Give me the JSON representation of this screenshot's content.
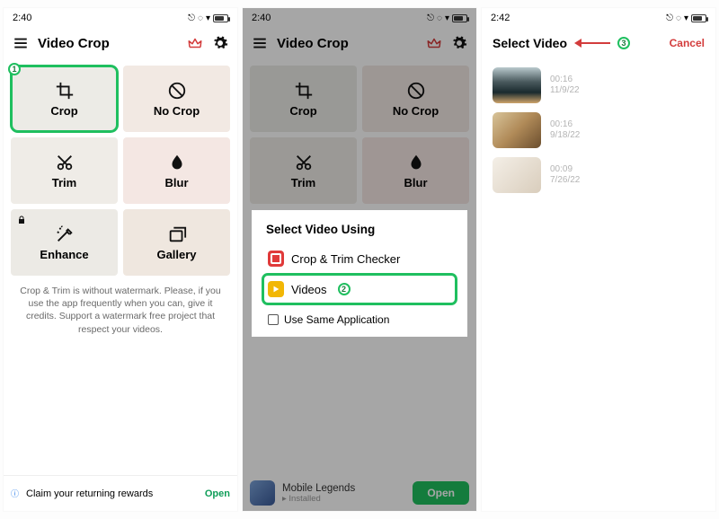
{
  "screen1": {
    "time": "2:40",
    "title": "Video Crop",
    "tiles": [
      {
        "label": "Crop",
        "icon": "crop-icon"
      },
      {
        "label": "No Crop",
        "icon": "nocrop-icon"
      },
      {
        "label": "Trim",
        "icon": "trim-icon"
      },
      {
        "label": "Blur",
        "icon": "blur-icon"
      },
      {
        "label": "Enhance",
        "icon": "enhance-icon"
      },
      {
        "label": "Gallery",
        "icon": "gallery-icon"
      }
    ],
    "blurb": "Crop & Trim is without watermark. Please, if you use the app frequently when you can, give it credits. Support a watermark free project that respect your videos.",
    "ad": {
      "text": "Claim your returning rewards",
      "cta": "Open"
    },
    "badge": "1"
  },
  "screen2": {
    "time": "2:40",
    "title": "Video Crop",
    "modal": {
      "title": "Select Video Using",
      "options": [
        {
          "label": "Crop & Trim Checker"
        },
        {
          "label": "Videos"
        }
      ],
      "checkbox": "Use Same Application",
      "badge": "2"
    },
    "ad": {
      "title": "Mobile Legends",
      "sub": "Installed",
      "cta": "Open"
    }
  },
  "screen3": {
    "time": "2:42",
    "title": "Select Video",
    "cancel": "Cancel",
    "badge": "3",
    "videos": [
      {
        "duration": "00:16",
        "date": "11/9/22"
      },
      {
        "duration": "00:16",
        "date": "9/18/22"
      },
      {
        "duration": "00:09",
        "date": "7/26/22"
      }
    ]
  }
}
